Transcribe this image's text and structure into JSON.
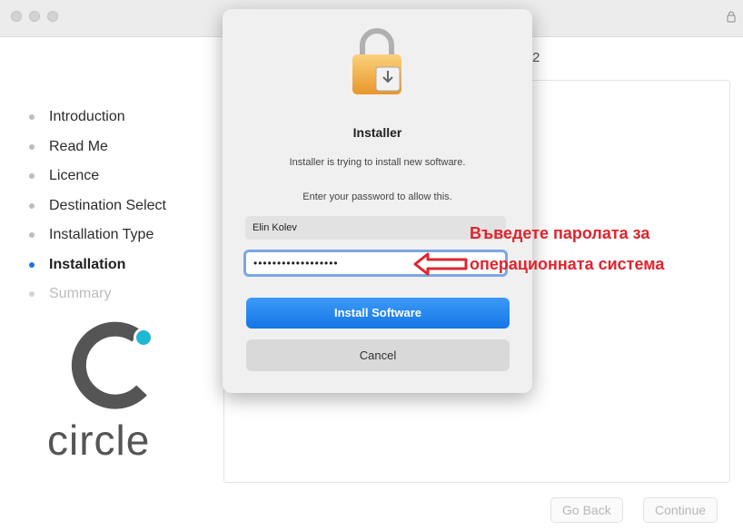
{
  "sidebar": {
    "steps": [
      {
        "label": "Introduction",
        "state": "done"
      },
      {
        "label": "Read Me",
        "state": "done"
      },
      {
        "label": "Licence",
        "state": "done"
      },
      {
        "label": "Destination Select",
        "state": "done"
      },
      {
        "label": "Installation Type",
        "state": "done"
      },
      {
        "label": "Installation",
        "state": "active"
      },
      {
        "label": "Summary",
        "state": "pending"
      }
    ],
    "logo_text": "circle"
  },
  "window": {
    "title_fragment": "2"
  },
  "footer": {
    "go_back_label": "Go Back",
    "continue_label": "Continue"
  },
  "dialog": {
    "icon": "lock-icon",
    "title": "Installer",
    "message": "Installer is trying to install new software.",
    "prompt": "Enter your password to allow this.",
    "username_value": "Elin Kolev",
    "password_value": "••••••••••••••••••",
    "install_label": "Install Software",
    "cancel_label": "Cancel"
  },
  "annotation": {
    "line1": "Въведете паролата за",
    "line2": "операционната система",
    "color": "#e0242d"
  },
  "colors": {
    "accent": "#1a73e8",
    "primary_button": "#1475e6"
  }
}
